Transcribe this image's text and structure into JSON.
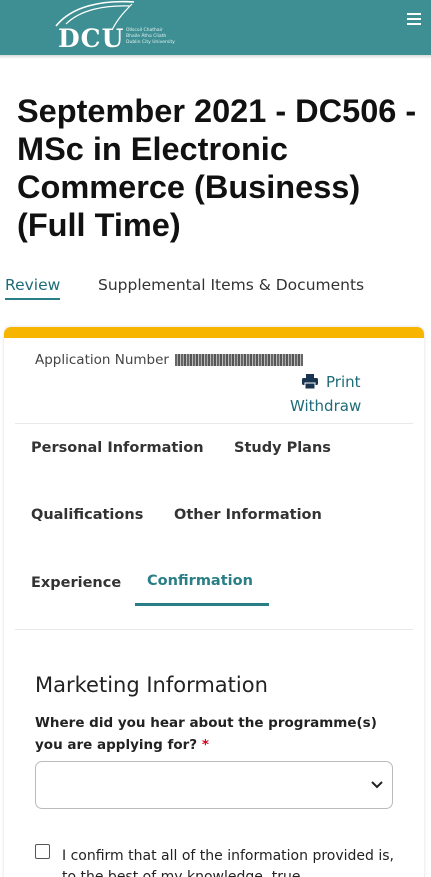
{
  "header": {
    "logo_text": "DCU",
    "logo_sub": [
      "Ollscoil Chathair",
      "Bhaile Átha Cliath",
      "Dublin City University"
    ],
    "menu_icon": "hamburger-menu-icon",
    "color": "#3e8f93"
  },
  "page": {
    "title": "September 2021 - DC506 - MSc in Electronic Commerce (Business) (Full Time)"
  },
  "top_tabs": [
    {
      "label": "Review",
      "active": true
    },
    {
      "label": "Supplemental Items & Documents",
      "active": false
    }
  ],
  "application": {
    "number_label": "Application Number",
    "number_value": "",
    "print_label": "Print",
    "print_icon": "printer-icon",
    "withdraw_label": "Withdraw"
  },
  "section_tabs": [
    {
      "label": "Personal Information",
      "active": false
    },
    {
      "label": "Study Plans",
      "active": false
    },
    {
      "label": "Qualifications",
      "active": false
    },
    {
      "label": "Other Information",
      "active": false
    },
    {
      "label": "Experience",
      "active": false
    },
    {
      "label": "Confirmation",
      "active": true
    }
  ],
  "marketing": {
    "title": "Marketing Information",
    "question": "Where did you hear about the programme(s) you are applying for?",
    "required_mark": "*",
    "selected_value": "",
    "chevron_icon": "chevron-down-icon"
  },
  "confirmation": {
    "checked": false,
    "text": "I confirm that all of the information provided is, to the best of my knowledge, true"
  },
  "colors": {
    "accent": "#2a7e85",
    "card_top": "#f7b500",
    "required": "#d0021b"
  }
}
